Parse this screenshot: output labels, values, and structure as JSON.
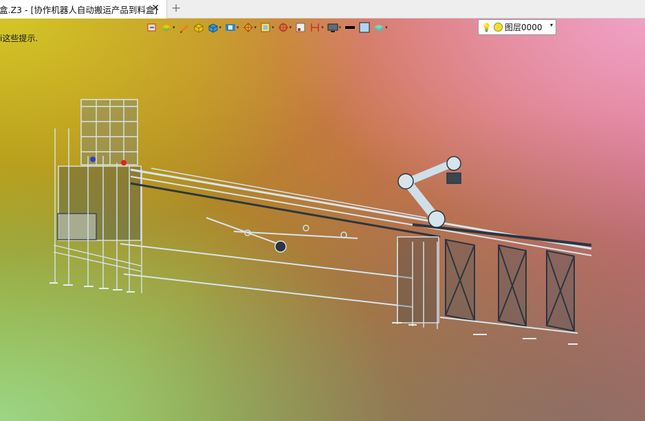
{
  "tab": {
    "title": "盒.Z3 - [协作机器人自动搬运产品到料盒]",
    "close_glyph": "✕",
    "add_glyph": "+"
  },
  "viewport": {
    "hint_text": "i这些提示."
  },
  "toolbar": {
    "icons": [
      "view-icon",
      "layer-manager-icon",
      "pen-icon",
      "shaded-box-icon",
      "solid-icon",
      "display-mode-icon",
      "render-icon",
      "frame-icon",
      "snap-icon",
      "grid-icon",
      "dimension-icon",
      "screen-icon",
      "line-color-icon",
      "fill-color-icon",
      "layer-stack-icon"
    ]
  },
  "layer": {
    "name": "图层0000",
    "dropdown_glyph": "▾"
  },
  "colors": {
    "model_stroke": "#cfe3ee",
    "model_dark": "#2b3640"
  }
}
